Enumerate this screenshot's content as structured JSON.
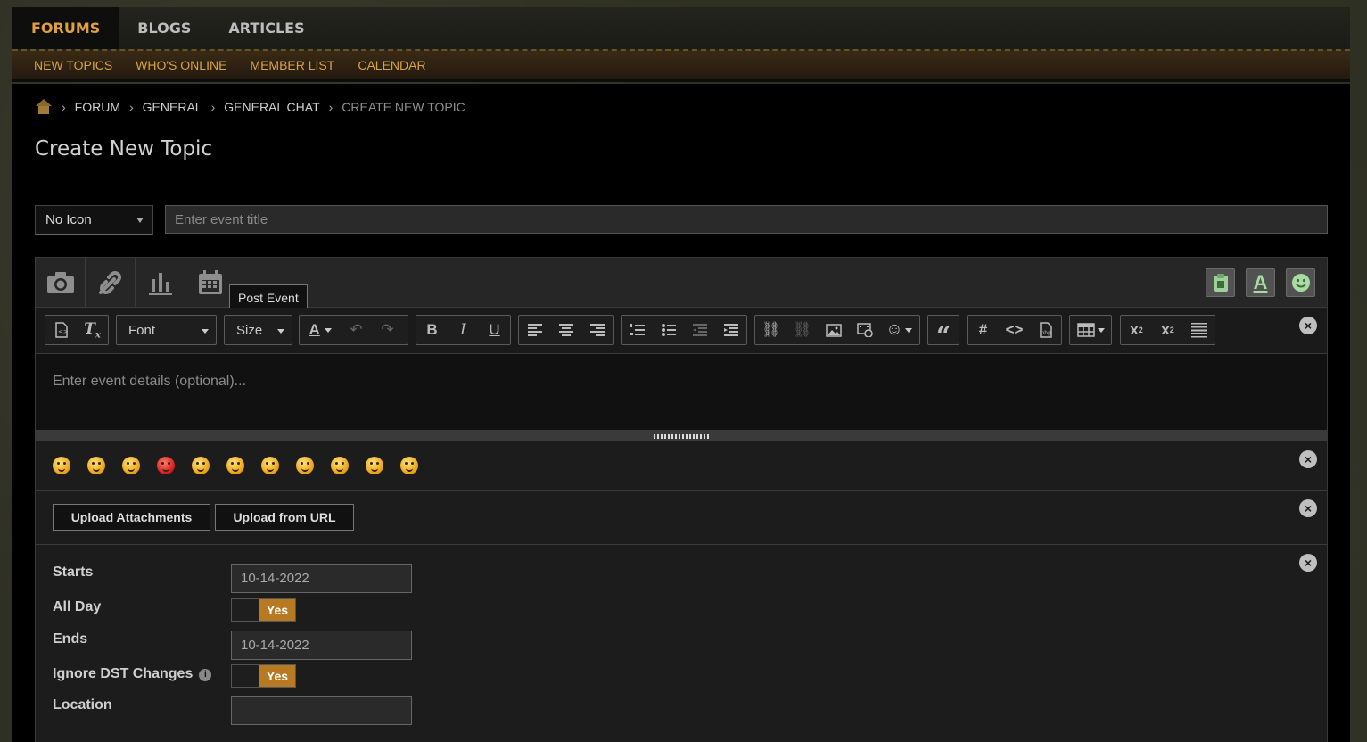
{
  "topnav": {
    "tabs": [
      "FORUMS",
      "BLOGS",
      "ARTICLES"
    ]
  },
  "subnav": {
    "links": [
      "NEW TOPICS",
      "WHO'S ONLINE",
      "MEMBER LIST",
      "CALENDAR"
    ]
  },
  "breadcrumb": {
    "items": [
      "FORUM",
      "GENERAL",
      "GENERAL CHAT"
    ],
    "current": "CREATE NEW TOPIC"
  },
  "page": {
    "title": "Create New Topic"
  },
  "form": {
    "icon_select": "No Icon",
    "title_placeholder": "Enter event title",
    "details_placeholder": "Enter event details (optional)..."
  },
  "toolbar": {
    "tooltip": "Post Event",
    "font_label": "Font",
    "size_label": "Size"
  },
  "uploads": {
    "attach_label": "Upload Attachments",
    "url_label": "Upload from URL"
  },
  "event": {
    "starts_label": "Starts",
    "starts_value": "10-14-2022",
    "allday_label": "All Day",
    "allday_value": "Yes",
    "ends_label": "Ends",
    "ends_value": "10-14-2022",
    "dst_label": "Ignore DST Changes",
    "dst_value": "Yes",
    "location_label": "Location",
    "location_value": ""
  },
  "colors": {
    "accent": "#e0a040",
    "toggle_on": "#b77a22"
  }
}
